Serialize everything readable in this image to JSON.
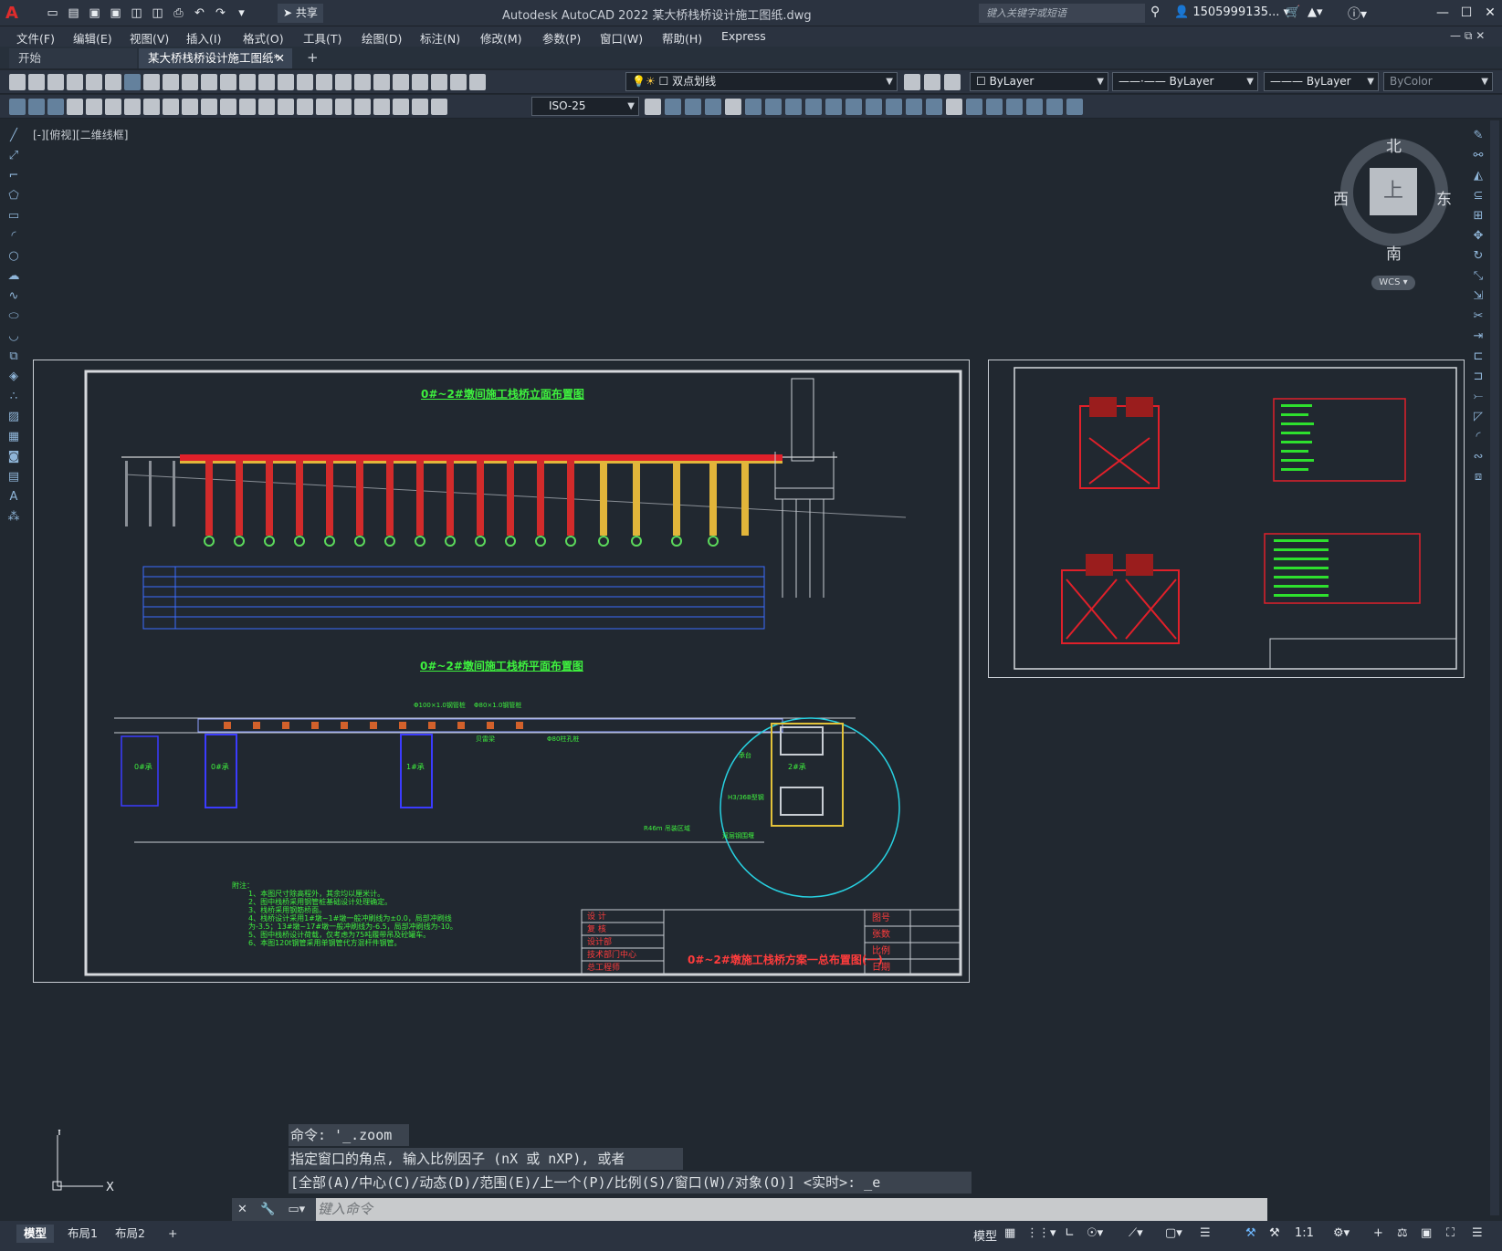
{
  "window": {
    "title": "Autodesk AutoCAD 2022    某大桥栈桥设计施工图纸.dwg",
    "search_placeholder": "键入关键字或短语",
    "user": "1505999135...",
    "share_label": "共享"
  },
  "menu": [
    "文件(F)",
    "编辑(E)",
    "视图(V)",
    "插入(I)",
    "格式(O)",
    "工具(T)",
    "绘图(D)",
    "标注(N)",
    "修改(M)",
    "参数(P)",
    "窗口(W)",
    "帮助(H)",
    "Express"
  ],
  "tabs": {
    "start": "开始",
    "active": "某大桥栈桥设计施工图纸*"
  },
  "toolbar": {
    "layer": "双点划线",
    "color": "ByLayer",
    "linetype": "ByLayer",
    "lineweight": "ByLayer",
    "plotstyle": "ByColor",
    "dimstyle": "ISO-25"
  },
  "viewport": {
    "label": "[-][俯视][二维线框]"
  },
  "viewcube": {
    "north": "北",
    "south": "南",
    "east": "东",
    "west": "西",
    "face": "上",
    "wcs": "WCS"
  },
  "drawing": {
    "title_elev": "0#~2#墩间施工栈桥立面布置图",
    "title_plan": "0#~2#墩间施工栈桥平面布置图",
    "title_block": "0#~2#墩施工栈桥方案一总布置图(一)",
    "tb_left": [
      "设 计",
      "复 核",
      "设计部",
      "技术部门中心",
      "总工程师"
    ],
    "tb_right": [
      "图号",
      "张数",
      "比例",
      "日期"
    ],
    "notes_title": "附注：",
    "notes": [
      "1、本图尺寸除高程外，其余均以厘米计。",
      "2、图中栈桥采用钢管桩基础设计处理确定。",
      "3、栈桥采用钢筋桥面。",
      "4、栈桥设计采用1#墩~1#墩一般冲刷线为±0.0，局部冲刷线",
      "   为-3.5；13#墩~17#墩一般冲刷线为-6.5，局部冲刷线为-10。",
      "5、图中栈桥设计荷载，仅考虑为75吨履带吊及砼罐车。",
      "6、本图120t钢管采用单钢管代方混杆件钢管。"
    ],
    "plan_labels": [
      "0#承",
      "0#承",
      "1#承",
      "2#承",
      "Φ100×1.0钢管桩",
      "Φ80×1.0钢管桩",
      "贝雷梁",
      "Φ80柱孔桩",
      "H3/36B型钢",
      "R46m 吊装区域",
      "双层钢围堰",
      "承台"
    ]
  },
  "command": {
    "history": [
      "命令: '_.zoom",
      "指定窗口的角点, 输入比例因子 (nX 或 nXP), 或者",
      "[全部(A)/中心(C)/动态(D)/范围(E)/上一个(P)/比例(S)/窗口(W)/对象(O)] <实时>: _e"
    ],
    "placeholder": "键入命令"
  },
  "layouts": [
    "模型",
    "布局1",
    "布局2"
  ],
  "status": {
    "model": "模型",
    "scale": "1:1"
  }
}
